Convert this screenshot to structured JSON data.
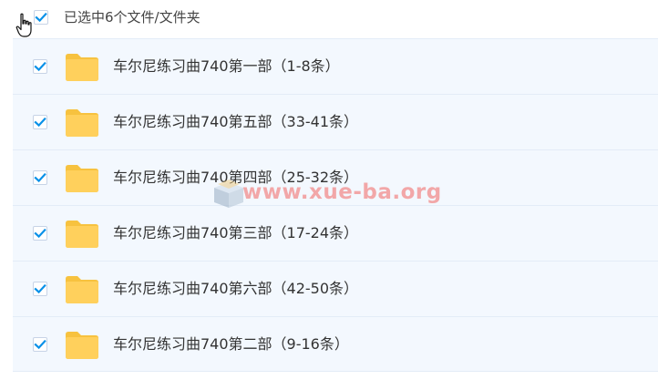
{
  "header": {
    "selection_text": "已选中6个文件/文件夹",
    "all_checked": true
  },
  "files": [
    {
      "name": "车尔尼练习曲740第一部（1-8条）",
      "checked": true,
      "icon": "folder-icon"
    },
    {
      "name": "车尔尼练习曲740第五部（33-41条）",
      "checked": true,
      "icon": "folder-icon"
    },
    {
      "name": "车尔尼练习曲740第四部（25-32条）",
      "checked": true,
      "icon": "folder-icon"
    },
    {
      "name": "车尔尼练习曲740第三部（17-24条）",
      "checked": true,
      "icon": "folder-icon"
    },
    {
      "name": "车尔尼练习曲740第六部（42-50条）",
      "checked": true,
      "icon": "folder-icon"
    },
    {
      "name": "车尔尼练习曲740第二部（9-16条）",
      "checked": true,
      "icon": "folder-icon"
    }
  ],
  "watermark": {
    "text": "www.xue-ba.org"
  },
  "colors": {
    "check_mark": "#0a91e8",
    "folder": "#ffd05c",
    "folder_tab": "#f7c23f",
    "row_background": "#f3f8fe",
    "row_border": "#e3ecf7",
    "watermark": "#f28c8c"
  }
}
